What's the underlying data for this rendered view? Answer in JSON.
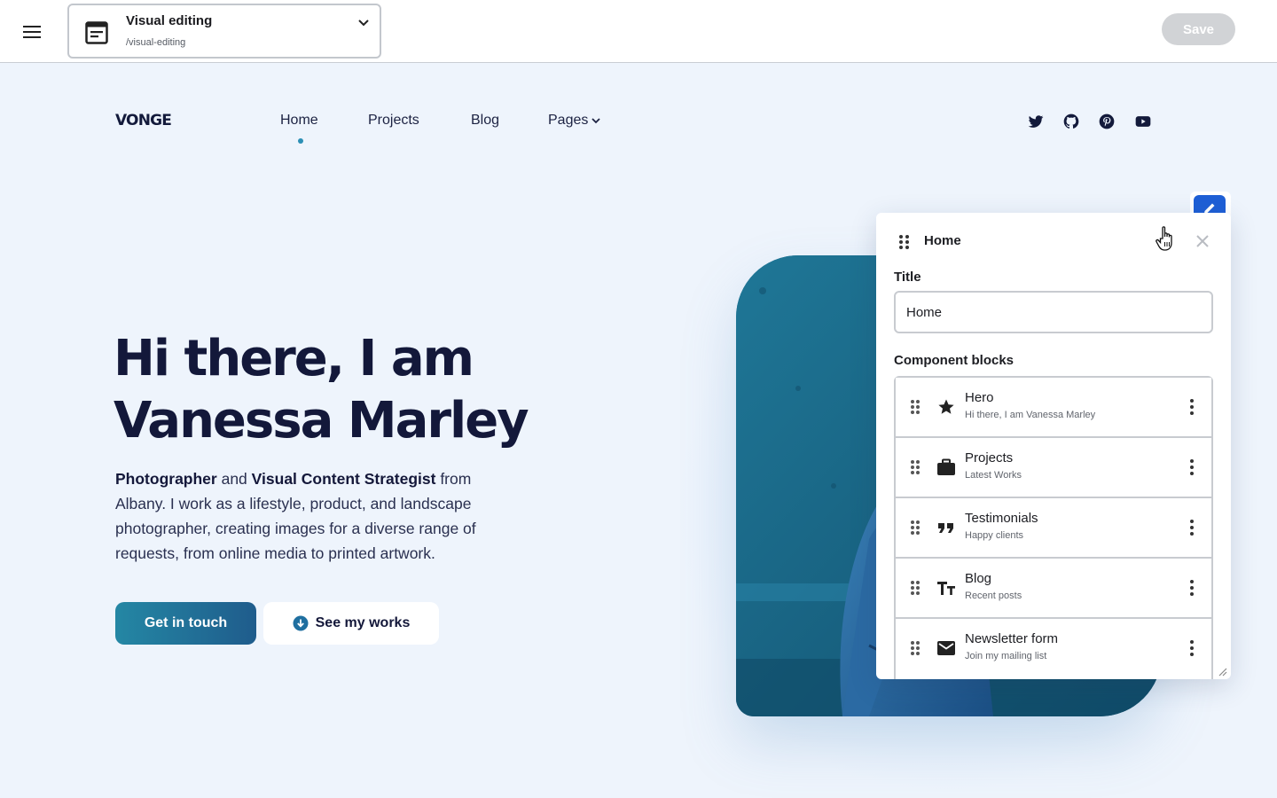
{
  "toolbar": {
    "menu_icon": "hamburger-menu-icon",
    "page_select": {
      "title": "Visual editing",
      "path": "/visual-editing",
      "icon": "page-document-icon"
    },
    "save_label": "Save",
    "save_disabled_color": "#d1d3d6"
  },
  "site": {
    "logo": "VONGE",
    "nav": [
      {
        "label": "Home",
        "active": true
      },
      {
        "label": "Projects"
      },
      {
        "label": "Blog"
      },
      {
        "label": "Pages"
      }
    ],
    "social_icons": [
      "twitter-icon",
      "github-icon",
      "pinterest-icon",
      "youtube-icon"
    ],
    "accent_color": "#2b8fb5"
  },
  "hero": {
    "title_line1": "Hi there, I am",
    "title_line2": "Vanessa Marley",
    "desc_b1": "Photographer",
    "desc_t1": " and ",
    "desc_b2": "Visual Content Strategist",
    "desc_t2": " from Albany. I work as a lifestyle, product, and landscape photographer, creating images for a diverse range of requests, from online media to printed artwork.",
    "cta_primary": "Get in touch",
    "cta_secondary": "See my works"
  },
  "editor": {
    "panel_title": "Home",
    "title_label": "Title",
    "title_value": "Home",
    "blocks_label": "Component blocks",
    "edit_button_color": "#1e5fd6",
    "blocks": [
      {
        "name": "Hero",
        "subtitle": "Hi there, I am Vanessa Marley",
        "icon": "star-icon"
      },
      {
        "name": "Projects",
        "subtitle": "Latest Works",
        "icon": "briefcase-icon"
      },
      {
        "name": "Testimonials",
        "subtitle": "Happy clients",
        "icon": "quote-icon"
      },
      {
        "name": "Blog",
        "subtitle": "Recent posts",
        "icon": "text-format-icon"
      },
      {
        "name": "Newsletter form",
        "subtitle": "Join my mailing list",
        "icon": "mail-icon"
      }
    ]
  }
}
